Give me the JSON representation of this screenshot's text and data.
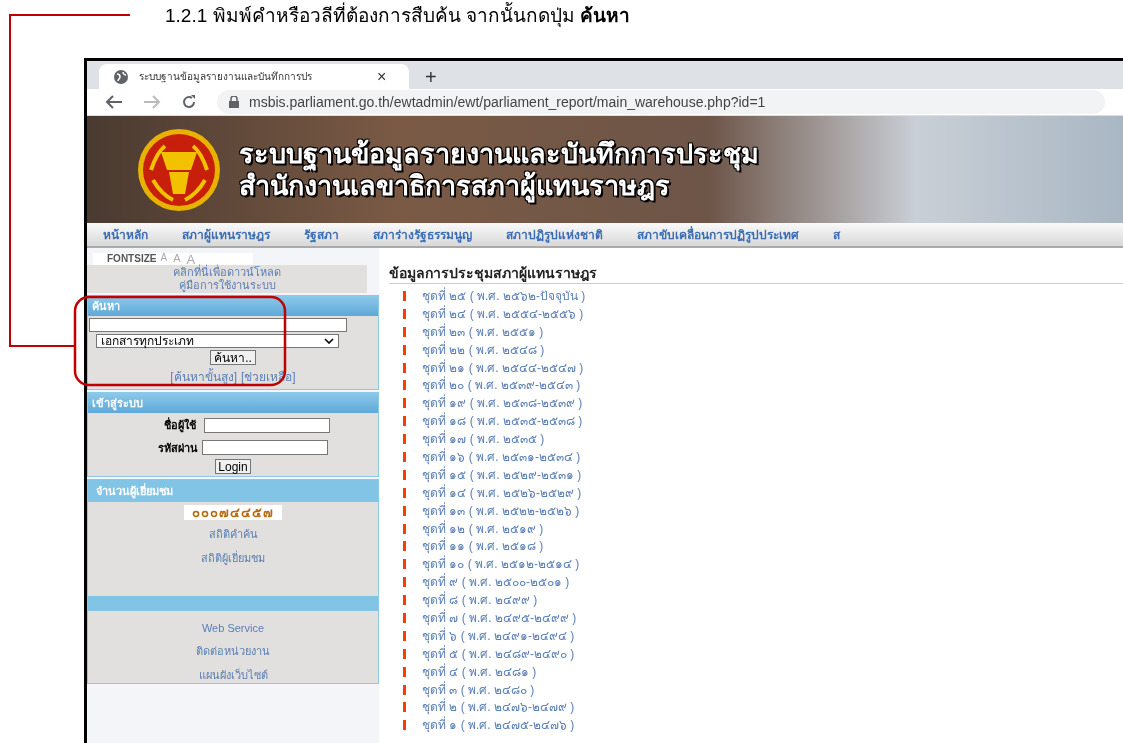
{
  "caption": "1.2.1 พิมพ์คำหรือวลีที่ต้องการสืบค้น  จากนั้นกดปุ่ม **ค้นหา**",
  "browser": {
    "tab_title": "ระบบฐานข้อมูลรายงานและบันทึกการปร",
    "tab_close": "×",
    "new_tab": "+",
    "url": "msbis.parliament.go.th/ewtadmin/ewt/parliament_report/main_warehouse.php?id=1"
  },
  "banner": {
    "title_lines": [
      "ระบบฐานข้อมูลรายงานและบันทึกการประชุม",
      "สำนักงานเลขาธิการสภาผู้แทนราษฎร"
    ]
  },
  "nav": [
    "หน้าหลัก",
    "สภาผู้แทนราษฎร",
    "รัฐสภา",
    "สภาร่างรัฐธรรมนูญ",
    "สภาปฏิรูปแห่งชาติ",
    "สภาขับเคลื่อนการปฏิรูปประเทศ",
    "ส"
  ],
  "sidebar": {
    "fontsize": {
      "label": "FONTSIZE",
      "sizes": [
        "A",
        "A",
        "A"
      ]
    },
    "manual_link": [
      "คลิกที่นี่เพื่อดาวน์โหลด",
      "คู่มือการใช้งานระบบ"
    ],
    "search": {
      "header": "ค้นหา",
      "type_select": "เอกสารทุกประเภท",
      "button": "ค้นหา..",
      "links": [
        "[ค้นหาขั้นสูง]",
        "[ช่วยเหลือ]"
      ]
    },
    "login": {
      "header": "เข้าสู่ระบบ",
      "username_label": "ชื่อผู้ใช้",
      "password_label": "รหัสผ่าน",
      "button": "Login"
    },
    "visitors": {
      "header": "จำนวนผู้เยี่ยมชม",
      "counter": "๐๐๐๗๔๔๕๗",
      "links": [
        "สถิติคำค้น",
        "สถิติผู้เยี่ยมชม"
      ]
    },
    "other_links": [
      "Web Service",
      "ติดต่อหน่วยงาน",
      "แผนผังเว็บไซต์"
    ]
  },
  "content": {
    "title": "ข้อมูลการประชุมสภาผู้แทนราษฎร",
    "items": [
      "ชุดที่ ๒๕ ( พ.ศ. ๒๕๖๒-ปัจจุบัน )",
      "ชุดที่ ๒๔ ( พ.ศ. ๒๕๕๔-๒๕๕๖ )",
      "ชุดที่ ๒๓ ( พ.ศ. ๒๕๕๑ )",
      "ชุดที่ ๒๒ ( พ.ศ. ๒๕๔๘ )",
      "ชุดที่ ๒๑ ( พ.ศ. ๒๕๔๔-๒๕๔๗ )",
      "ชุดที่ ๒๐ ( พ.ศ. ๒๕๓๙-๒๕๔๓ )",
      "ชุดที่ ๑๙ ( พ.ศ. ๒๕๓๘-๒๕๓๙ )",
      "ชุดที่ ๑๘ ( พ.ศ. ๒๕๓๕-๒๕๓๘ )",
      "ชุดที่ ๑๗ ( พ.ศ. ๒๕๓๕ )",
      "ชุดที่ ๑๖ ( พ.ศ. ๒๕๓๑-๒๕๓๔ )",
      "ชุดที่ ๑๕ ( พ.ศ. ๒๕๒๙-๒๕๓๑ )",
      "ชุดที่ ๑๔ ( พ.ศ. ๒๕๒๖-๒๕๒๙ )",
      "ชุดที่ ๑๓ ( พ.ศ. ๒๕๒๒-๒๕๒๖ )",
      "ชุดที่ ๑๒ ( พ.ศ. ๒๕๑๙ )",
      "ชุดที่ ๑๑ ( พ.ศ. ๒๕๑๘ )",
      "ชุดที่ ๑๐ ( พ.ศ. ๒๕๑๒-๒๕๑๔ )",
      "ชุดที่ ๙ ( พ.ศ. ๒๕๐๐-๒๕๐๑ )",
      "ชุดที่ ๘ ( พ.ศ. ๒๔๙๙ )",
      "ชุดที่ ๗ ( พ.ศ. ๒๔๙๕-๒๔๙๙ )",
      "ชุดที่ ๖ ( พ.ศ. ๒๔๙๑-๒๔๙๔ )",
      "ชุดที่ ๕ ( พ.ศ. ๒๔๘๙-๒๔๙๐ )",
      "ชุดที่ ๔ ( พ.ศ. ๒๔๘๑ )",
      "ชุดที่ ๓ ( พ.ศ. ๒๔๘๐ )",
      "ชุดที่ ๒ ( พ.ศ. ๒๔๗๖-๒๔๗๙ )",
      "ชุดที่ ๑ ( พ.ศ. ๒๔๗๕-๒๔๗๖ )"
    ]
  }
}
